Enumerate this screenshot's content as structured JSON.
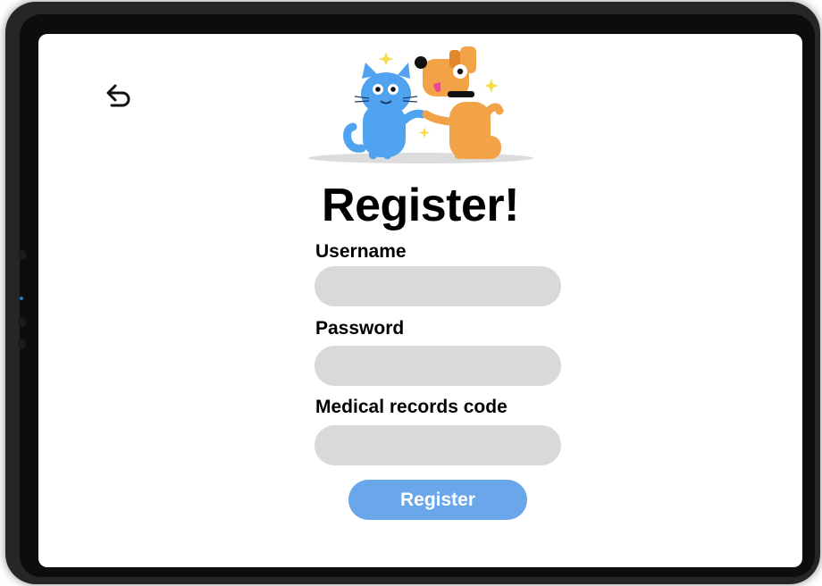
{
  "page": {
    "title": "Register!"
  },
  "form": {
    "fields": [
      {
        "label": "Username",
        "value": "",
        "placeholder": ""
      },
      {
        "label": "Password",
        "value": "",
        "placeholder": ""
      },
      {
        "label": "Medical records code",
        "value": "",
        "placeholder": ""
      }
    ],
    "submit_label": "Register"
  },
  "icons": {
    "back": "undo-arrow-icon",
    "hero": "cat-and-dog-illustration"
  },
  "colors": {
    "accent": "#6aa6ea",
    "field_bg": "#d9d9d9",
    "cat": "#4fa3f0",
    "dog": "#f2a247",
    "sparkle": "#f7dc4a"
  }
}
